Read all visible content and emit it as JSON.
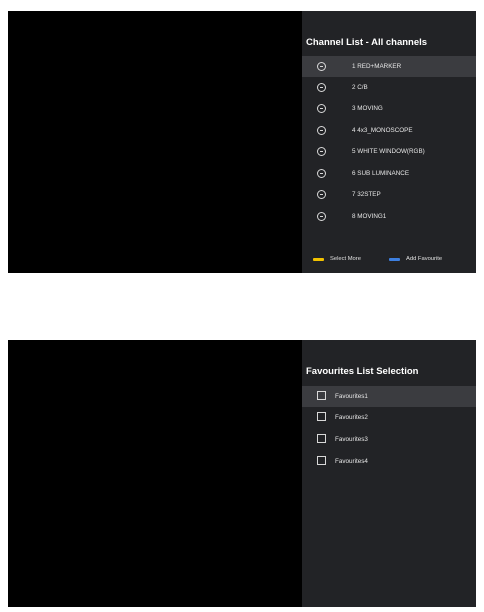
{
  "channel_list": {
    "title": "Channel List - All channels",
    "items": [
      {
        "label": "1 RED+MARKER",
        "selected": true
      },
      {
        "label": "2 C/B"
      },
      {
        "label": "3 MOVING"
      },
      {
        "label": "4 4x3_MONOSCOPE"
      },
      {
        "label": "5 WHITE WINDOW(RGB)"
      },
      {
        "label": "6 SUB LUMINANCE"
      },
      {
        "label": "7 32STEP"
      },
      {
        "label": "8 MOVING1"
      }
    ],
    "legend": [
      {
        "label": "Select More",
        "color": "#f2c200"
      },
      {
        "label": "Add Favourite",
        "color": "#3d7fe0"
      }
    ]
  },
  "favourites": {
    "title": "Favourites List Selection",
    "items": [
      {
        "label": "Favourites1",
        "selected": true
      },
      {
        "label": "Favourites2"
      },
      {
        "label": "Favourites3"
      },
      {
        "label": "Favourites4"
      }
    ]
  }
}
